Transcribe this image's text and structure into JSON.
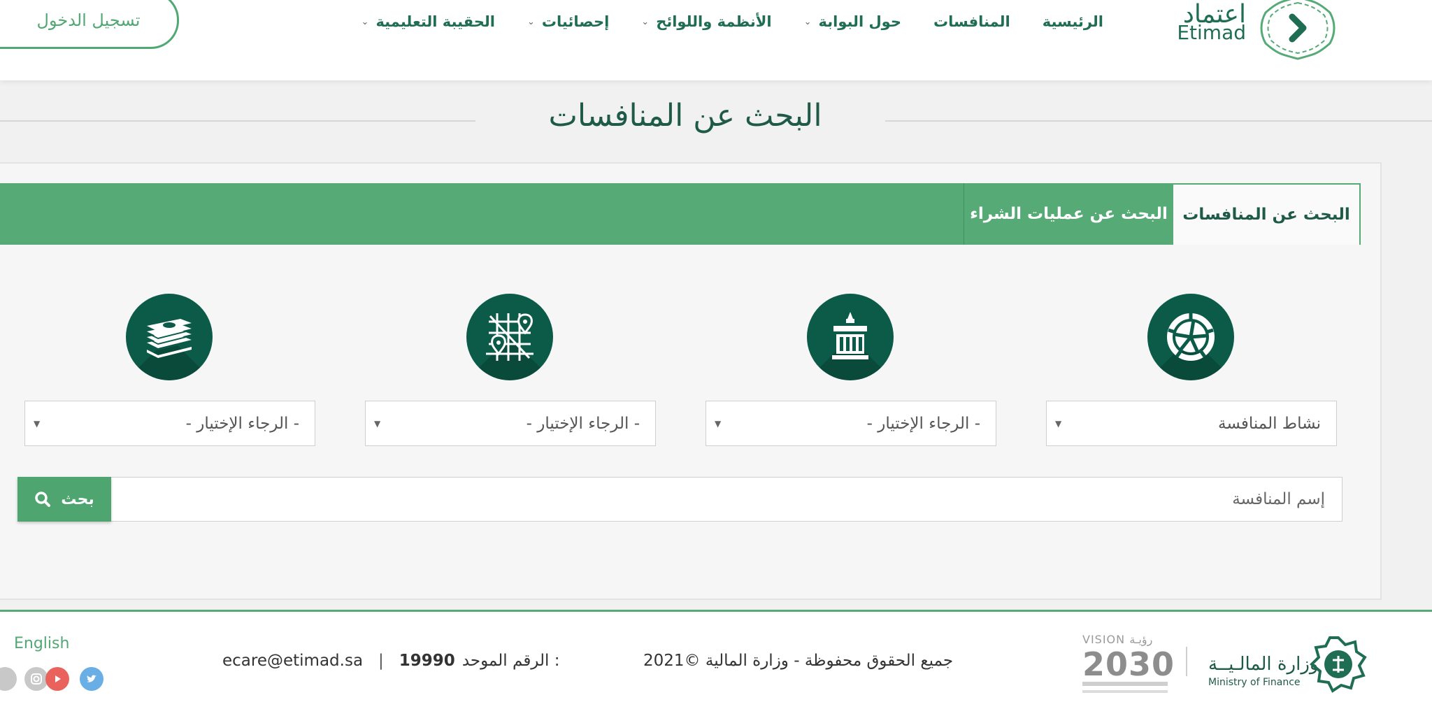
{
  "header": {
    "login_label": "تسجيل الدخول",
    "logo": {
      "arabic": "اعتماد",
      "english": "Etimad"
    },
    "nav": [
      {
        "label": "الرئيسية",
        "has_dropdown": false
      },
      {
        "label": "المنافسات",
        "has_dropdown": false
      },
      {
        "label": "حول البوابة",
        "has_dropdown": true
      },
      {
        "label": "الأنظمة واللوائح",
        "has_dropdown": true
      },
      {
        "label": "إحصائيات",
        "has_dropdown": true
      },
      {
        "label": "الحقيبة التعليمية",
        "has_dropdown": true
      }
    ]
  },
  "page_title": "البحث عن المنافسات",
  "tabs": {
    "active": "البحث عن المنافسات",
    "second": "البحث عن عمليات الشراء"
  },
  "filters": [
    {
      "icon": "activity-pie-icon",
      "value": "نشاط المنافسة"
    },
    {
      "icon": "government-building-icon",
      "value": "- الرجاء الإختيار -"
    },
    {
      "icon": "map-location-icon",
      "value": "- الرجاء الإختيار -"
    },
    {
      "icon": "money-stack-icon",
      "value": "- الرجاء الإختيار -"
    }
  ],
  "search": {
    "placeholder": "إسم المنافسة",
    "button_label": "بحث"
  },
  "footer": {
    "language": "English",
    "email": "ecare@etimad.sa",
    "separator": "|",
    "phone_label": "الرقم الموحد :",
    "phone": "19990",
    "copyright": "جميع الحقوق محفوظة - وزارة المالية ©2021",
    "vision_label": "VISION رؤيـة",
    "vision_year": "2030",
    "ministry_ar": "وزارة المالـيــة",
    "ministry_en": "Ministry of Finance",
    "social": [
      "twitter-icon",
      "youtube-icon",
      "instagram-icon",
      "linkedin-icon"
    ]
  },
  "colors": {
    "brand_green": "#56aa76",
    "dark_green": "#0c5b49",
    "title_green": "#1f5a48"
  }
}
